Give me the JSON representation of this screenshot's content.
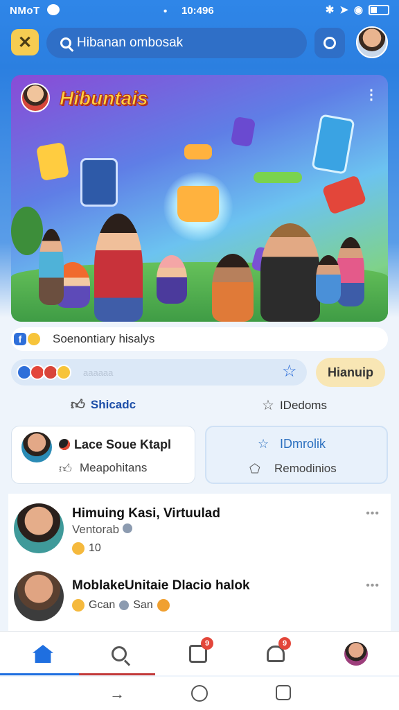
{
  "status_bar": {
    "carrier": "NMoT",
    "time": "10:496"
  },
  "header": {
    "brand_icon": "x-logo-icon",
    "search_text": "Hibanan ombosak"
  },
  "hero": {
    "title": "Hibuntais"
  },
  "chips": {
    "label": "Soenontiary hisalys"
  },
  "react_bar": {
    "ghost_text": "aaaaaa",
    "pill_label": "Hianuip"
  },
  "actions": {
    "left_label": "Shicadc",
    "right_label": "IDedoms"
  },
  "cards": {
    "left_title": "Lace Soue Ktapl",
    "left_sub": "Meapohitans",
    "right_title": "IDmrolik",
    "right_sub": "Remodinios"
  },
  "feed": [
    {
      "name": "Himuing Kasi, Virtuulad",
      "sub": "Ventorab",
      "meta": "10"
    },
    {
      "name": "MoblakeUnitaie Dlacio halok",
      "meta1": "Gcan",
      "meta2": "San"
    }
  ],
  "bottom_nav": {
    "calendar_badge": "9",
    "bell_badge": "9"
  },
  "colors": {
    "header_blue": "#2b7fe0",
    "accent_blue": "#1f6fe0",
    "pill_yellow": "#f8e6b4",
    "badge_red": "#e3463a"
  }
}
